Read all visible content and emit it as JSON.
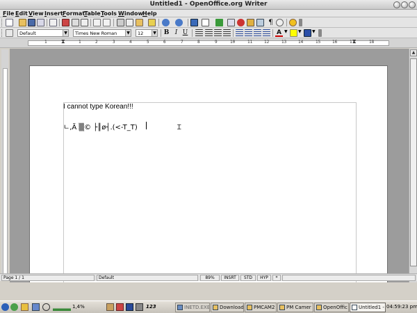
{
  "window": {
    "title": "Untitled1 - OpenOffice.org Writer"
  },
  "menu": [
    "File",
    "Edit",
    "View",
    "Insert",
    "Format",
    "Table",
    "Tools",
    "Window",
    "Help"
  ],
  "formatting": {
    "style": "Default",
    "font": "Times New Roman",
    "size": "12"
  },
  "ruler": {
    "numbers": [
      "1",
      "1",
      "2",
      "3",
      "4",
      "5",
      "6",
      "7",
      "8",
      "9",
      "10",
      "11",
      "12",
      "13",
      "14",
      "15",
      "16",
      "17",
      "18"
    ]
  },
  "document": {
    "line1": "I cannot type Korean!!!",
    "line2": "ㄴ,Ã ▒© ├║ø┤.(<-T_T)"
  },
  "status": {
    "page": "Page 1 / 1",
    "style": "Default",
    "zoom": "89%",
    "insert": "INSRT",
    "selection": "STD",
    "hyperlink": "HYP",
    "modified": "*"
  },
  "taskbar": {
    "cpu": "1,4%",
    "number": "123",
    "buttons": [
      "INETD.EXE",
      "Download",
      "PMCAM2",
      "PM Camer",
      "OpenOffic",
      "Untitled1 -"
    ],
    "clock": "04:59:23 pm"
  },
  "colors": {
    "font_color": "#cc0000",
    "highlight": "#ffff00",
    "background_fill": "#2b4fa8"
  }
}
